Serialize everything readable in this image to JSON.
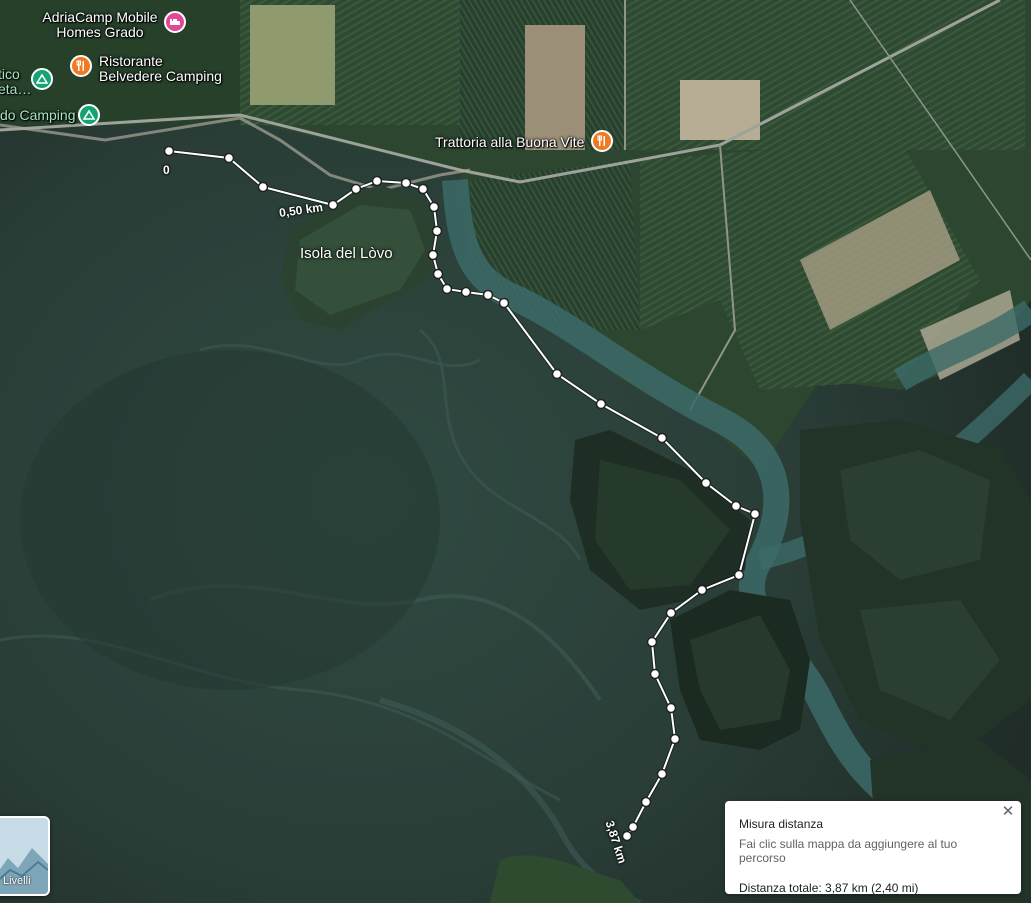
{
  "places": {
    "adriacamp": "AdriaCamp Mobile Homes Grado",
    "ristorante": "Ristorante Belvedere Camping",
    "trattoria": "Trattoria alla Buona Vite",
    "camping_left": "do Camping",
    "camping_partial": "tico eta…",
    "isola": "Isola del Lòvo"
  },
  "icons": {
    "hotel": "hotel-bed-icon",
    "restaurant": "fork-knife-icon",
    "campground": "tent-triangle-icon"
  },
  "colors": {
    "hotel": "#e2479a",
    "restaurant": "#ef7a22",
    "campground": "#15a374",
    "route": "#ffffff"
  },
  "measure": {
    "title": "Misura distanza",
    "hint": "Fai clic sulla mappa da aggiungere al tuo percorso",
    "total": "Distanza totale: 3,87 km (2,40 mi)",
    "close": "✕"
  },
  "route_labels": {
    "start": "0",
    "mid": "0,50 km",
    "end": "3,87 km"
  },
  "layers": {
    "label": "Livelli"
  }
}
